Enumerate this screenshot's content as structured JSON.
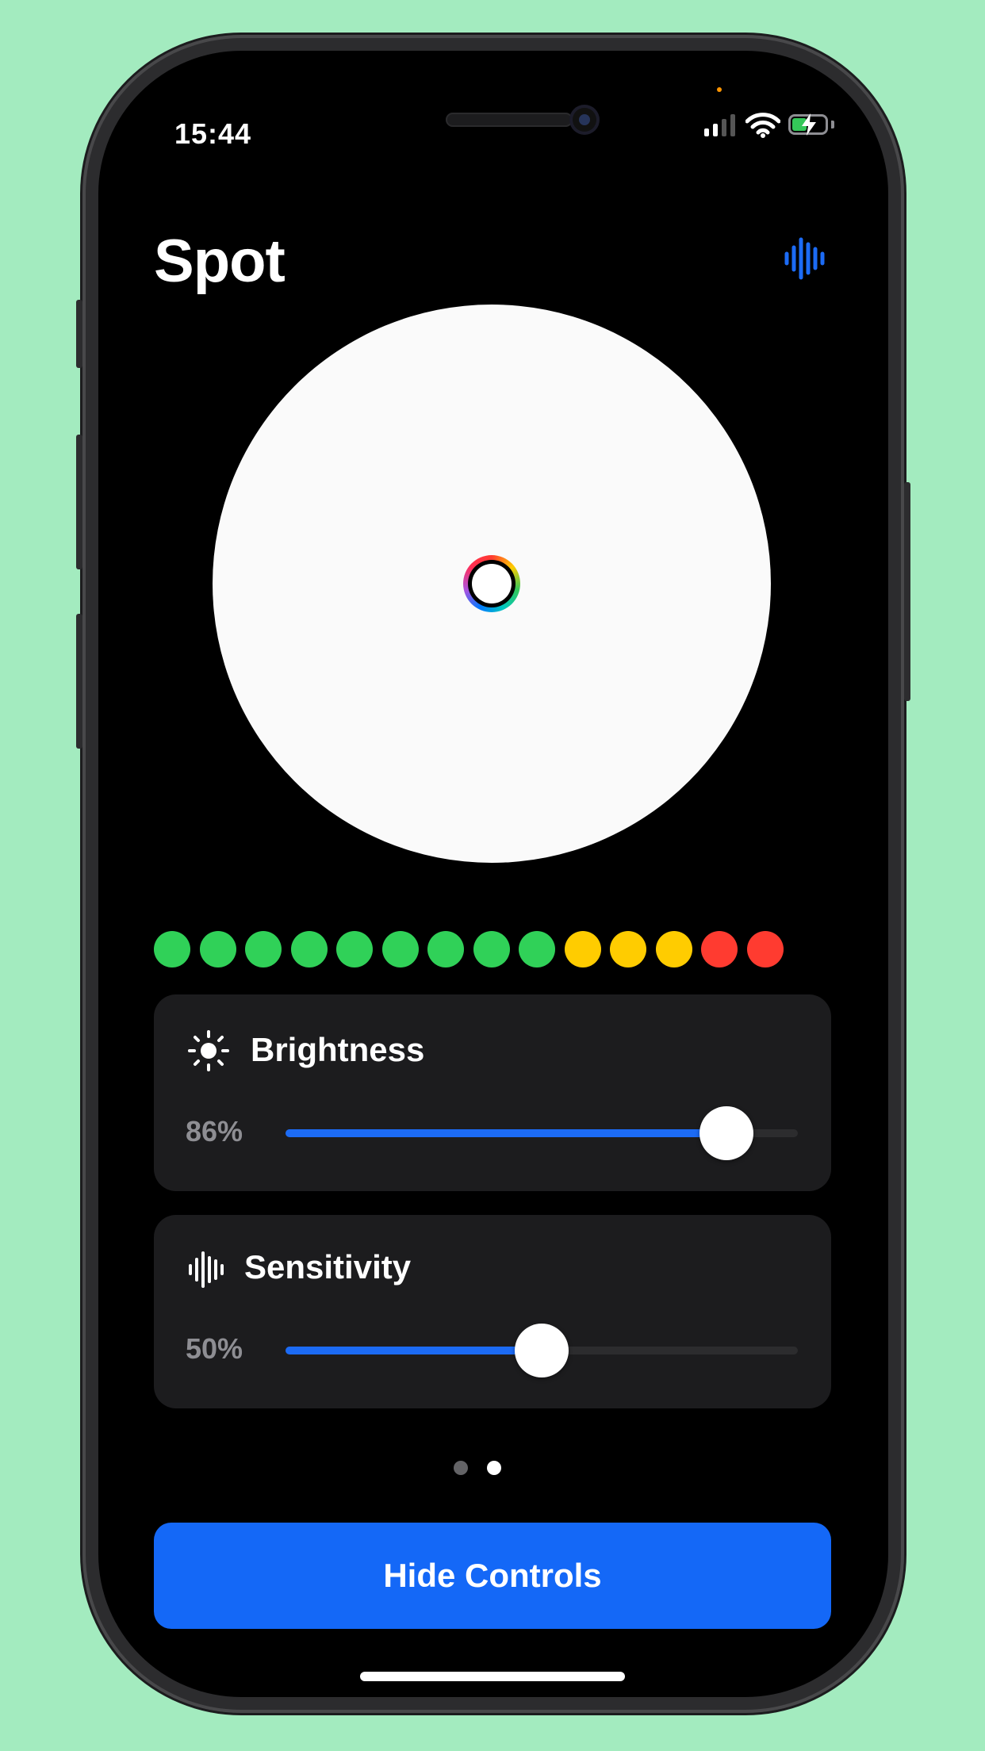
{
  "status_bar": {
    "time": "15:44"
  },
  "header": {
    "title": "Spot",
    "action_icon": "sound-wave-icon",
    "accent": "#1c6bf5"
  },
  "spot": {
    "color": "#fafafa",
    "picker_icon": "color-picker-icon"
  },
  "levels": {
    "colors": [
      "#30d158",
      "#30d158",
      "#30d158",
      "#30d158",
      "#30d158",
      "#30d158",
      "#30d158",
      "#30d158",
      "#30d158",
      "#ffcc00",
      "#ffcc00",
      "#ffcc00",
      "#ff3b30",
      "#ff3b30"
    ]
  },
  "controls": {
    "brightness": {
      "label": "Brightness",
      "icon": "sun-icon",
      "value_text": "86%",
      "fraction": 0.86
    },
    "sensitivity": {
      "label": "Sensitivity",
      "icon": "sound-wave-icon",
      "value_text": "50%",
      "fraction": 0.5
    }
  },
  "pager": {
    "count": 2,
    "active_index": 1
  },
  "hide_button": {
    "label": "Hide Controls",
    "color": "#1468f7"
  }
}
